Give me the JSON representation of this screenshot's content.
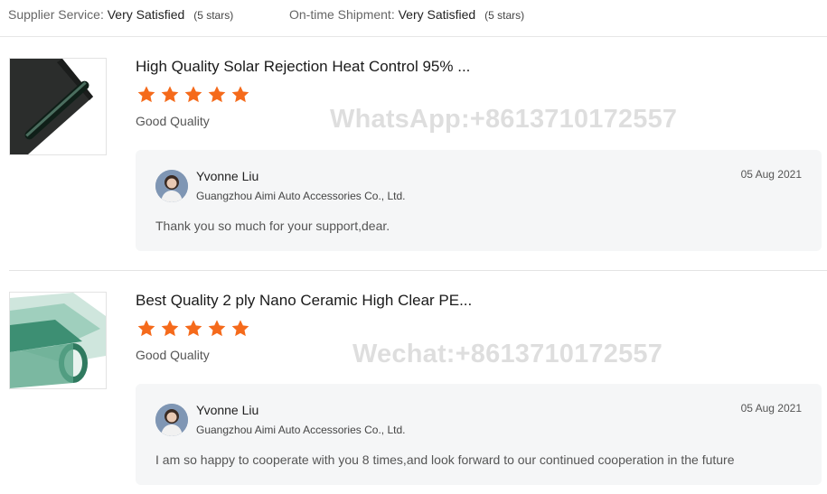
{
  "summary": {
    "supplier_service": {
      "label": "Supplier Service:",
      "value": "Very Satisfied",
      "stars": "(5 stars)"
    },
    "ontime_shipment": {
      "label": "On-time Shipment:",
      "value": "Very Satisfied",
      "stars": "(5 stars)"
    }
  },
  "reviews": [
    {
      "product_title": "High Quality Solar Rejection Heat Control 95% ...",
      "rating": 5,
      "quality": "Good Quality",
      "watermark": "WhatsApp:+8613710172557",
      "reply": {
        "name": "Yvonne Liu",
        "company": "Guangzhou Aimi Auto Accessories Co., Ltd.",
        "date": "05 Aug 2021",
        "text": "Thank you so much for your support,dear."
      }
    },
    {
      "product_title": "Best Quality 2 ply Nano Ceramic High Clear PE...",
      "rating": 5,
      "quality": "Good Quality",
      "watermark": "Wechat:+8613710172557",
      "reply": {
        "name": "Yvonne Liu",
        "company": "Guangzhou Aimi Auto Accessories Co., Ltd.",
        "date": "05 Aug 2021",
        "text": "I am so happy to cooperate with you 8 times,and look forward to our continued cooperation in the future"
      }
    }
  ],
  "colors": {
    "star": "#f56a1b",
    "reply_bg": "#f5f6f7"
  },
  "icons": {
    "star": "star-icon",
    "avatar": "avatar"
  }
}
